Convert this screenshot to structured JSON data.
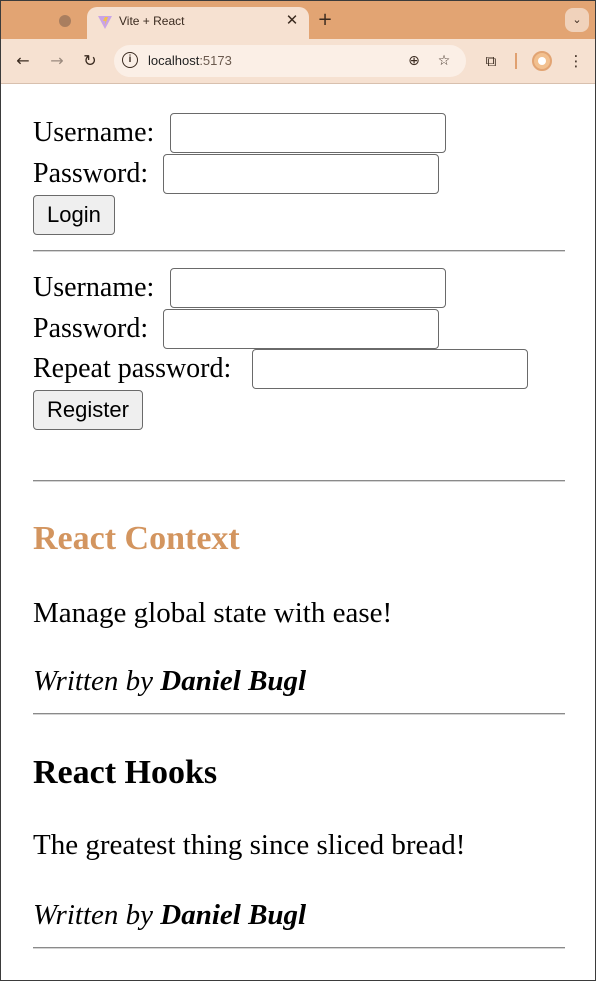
{
  "browser": {
    "tab": {
      "title": "Vite + React",
      "close_glyph": "✕",
      "favicon": "vite-icon"
    },
    "new_tab_glyph": "+",
    "tab_list_glyph": "⌄",
    "nav": {
      "back": "←",
      "forward": "→",
      "reload": "↻"
    },
    "address": {
      "host": "localhost",
      "port": ":5173"
    },
    "icons": {
      "site_info": "i",
      "zoom": "⊕",
      "bookmark": "☆",
      "extensions": "⧉",
      "menu": "⋮"
    }
  },
  "login_form": {
    "username_label": "Username:",
    "password_label": "Password:",
    "submit_label": "Login",
    "username_value": "",
    "password_value": ""
  },
  "register_form": {
    "username_label": "Username:",
    "password_label": "Password:",
    "repeat_label": "Repeat password:",
    "submit_label": "Register",
    "username_value": "",
    "password_value": "",
    "repeat_value": ""
  },
  "posts": [
    {
      "title": "React Context",
      "title_color": "#d3955f",
      "body": "Manage global state with ease!",
      "written_by": "Written by",
      "author": "Daniel Bugl"
    },
    {
      "title": "React Hooks",
      "title_color": "#000000",
      "body": "The greatest thing since sliced bread!",
      "written_by": "Written by",
      "author": "Daniel Bugl"
    }
  ]
}
